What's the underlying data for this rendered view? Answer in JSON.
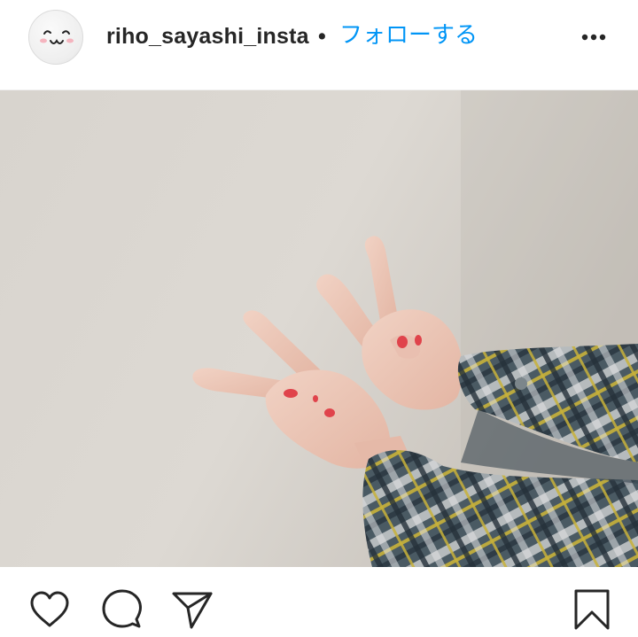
{
  "post": {
    "header": {
      "avatar_icon": "smiley-face-avatar",
      "username": "riho_sayashi_insta",
      "separator": "•",
      "follow_label": "フォローする",
      "more_icon": "more-options-icon"
    },
    "photo": {
      "subject_icon": "peace-sign-hands-photo"
    },
    "actions": {
      "like_icon": "heart-icon",
      "comment_icon": "comment-bubble-icon",
      "share_icon": "paper-plane-icon",
      "save_icon": "bookmark-icon"
    }
  },
  "colors": {
    "link_blue": "#0095f6",
    "text_dark": "#262626",
    "wall_beige": "#d9d5cf",
    "nail_red": "#e0434b"
  }
}
